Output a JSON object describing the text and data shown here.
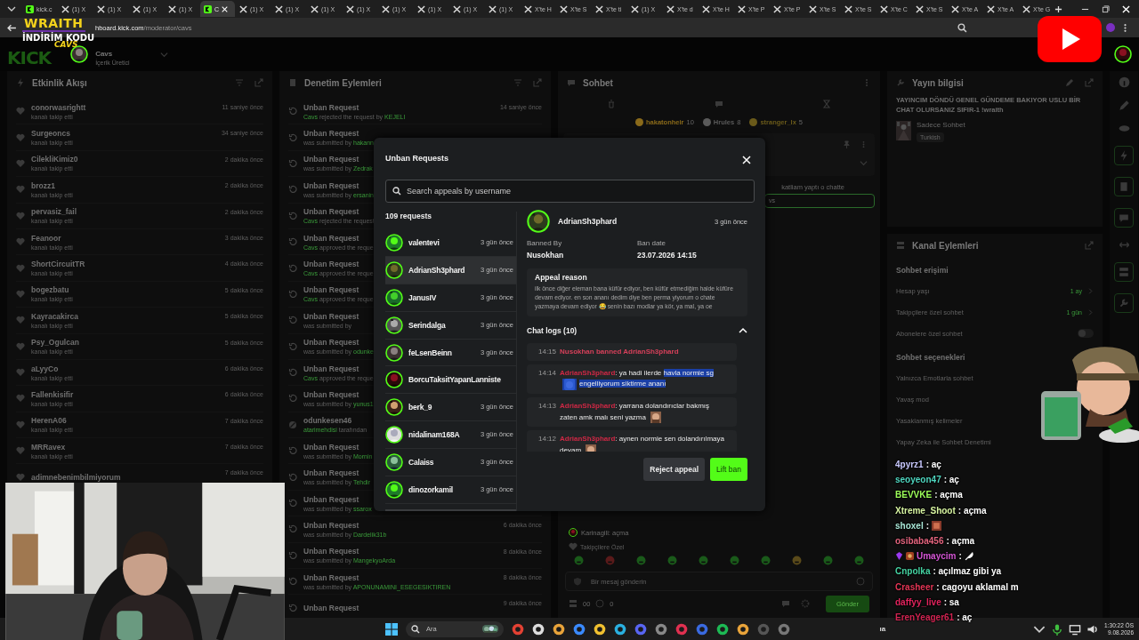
{
  "browser": {
    "tabs": [
      {
        "kind": "kick",
        "label": "kick.c",
        "selected": false
      },
      {
        "kind": "x",
        "label": "(1) X",
        "selected": false
      },
      {
        "kind": "x",
        "label": "(1) X",
        "selected": false
      },
      {
        "kind": "x",
        "label": "(1) X",
        "selected": false
      },
      {
        "kind": "x",
        "label": "(1) X",
        "selected": false
      },
      {
        "kind": "kick",
        "label": "C",
        "selected": true
      },
      {
        "kind": "x",
        "label": "(1) X",
        "selected": false
      },
      {
        "kind": "x",
        "label": "(1) X",
        "selected": false
      },
      {
        "kind": "x",
        "label": "(1) X",
        "selected": false
      },
      {
        "kind": "x",
        "label": "(1) X",
        "selected": false
      },
      {
        "kind": "x",
        "label": "(1) X",
        "selected": false
      },
      {
        "kind": "x",
        "label": "(1) X",
        "selected": false
      },
      {
        "kind": "x",
        "label": "(1) X",
        "selected": false
      },
      {
        "kind": "x",
        "label": "(1) X",
        "selected": false
      },
      {
        "kind": "x",
        "label": "X'te H",
        "selected": false
      },
      {
        "kind": "x",
        "label": "X'te S",
        "selected": false
      },
      {
        "kind": "x",
        "label": "X'te ti",
        "selected": false
      },
      {
        "kind": "x",
        "label": "(1) X",
        "selected": false
      },
      {
        "kind": "x",
        "label": "X'te d",
        "selected": false
      },
      {
        "kind": "x",
        "label": "X'te H",
        "selected": false
      },
      {
        "kind": "x",
        "label": "X'te P",
        "selected": false
      },
      {
        "kind": "x",
        "label": "X'te P",
        "selected": false
      },
      {
        "kind": "x",
        "label": "X'te S",
        "selected": false
      },
      {
        "kind": "x",
        "label": "X'te S",
        "selected": false
      },
      {
        "kind": "x",
        "label": "X'te C",
        "selected": false
      },
      {
        "kind": "x",
        "label": "X'te S",
        "selected": false
      },
      {
        "kind": "x",
        "label": "X'te A",
        "selected": false
      },
      {
        "kind": "x",
        "label": "X'te A",
        "selected": false
      },
      {
        "kind": "x",
        "label": "X'te G",
        "selected": false
      }
    ],
    "address": {
      "host": "hboard.kick.com",
      "path": "/moderator/cavs"
    }
  },
  "promo_overlay": {
    "brand": "WRAITH",
    "line": "İNDİRİM KODU",
    "code": "CAVS"
  },
  "header": {
    "logo": "KICK",
    "channel": "Cavs",
    "role": "İçerik Üretici"
  },
  "activity": {
    "title": "Etkinlik Akışı",
    "items": [
      {
        "name": "conorwasrightt",
        "action": "kanalı takip etti",
        "time": "11 saniye önce"
      },
      {
        "name": "Surgeoncs",
        "action": "kanalı takip etti",
        "time": "34 saniye önce"
      },
      {
        "name": "CilekliKimiz0",
        "action": "kanalı takip etti",
        "time": "2 dakika önce"
      },
      {
        "name": "brozz1",
        "action": "kanalı takip etti",
        "time": "2 dakika önce"
      },
      {
        "name": "pervasiz_fail",
        "action": "kanalı takip etti",
        "time": "2 dakika önce"
      },
      {
        "name": "Feanoor",
        "action": "kanalı takip etti",
        "time": "3 dakika önce"
      },
      {
        "name": "ShortCircuitTR",
        "action": "kanalı takip etti",
        "time": "4 dakika önce"
      },
      {
        "name": "bogezbatu",
        "action": "kanalı takip etti",
        "time": "5 dakika önce"
      },
      {
        "name": "Kayracakirca",
        "action": "kanalı takip etti",
        "time": "5 dakika önce"
      },
      {
        "name": "Psy_Ogulcan",
        "action": "kanalı takip etti",
        "time": "5 dakika önce"
      },
      {
        "name": "aLyyCo",
        "action": "kanalı takip etti",
        "time": "6 dakika önce"
      },
      {
        "name": "Fallenkisifir",
        "action": "kanalı takip etti",
        "time": "6 dakika önce"
      },
      {
        "name": "HerenA06",
        "action": "kanalı takip etti",
        "time": "7 dakika önce"
      },
      {
        "name": "MRRavex",
        "action": "kanalı takip etti",
        "time": "7 dakika önce"
      },
      {
        "name": "adimnebenimbilmiyorum",
        "time": "7 dakika önce"
      }
    ]
  },
  "moderation": {
    "title": "Denetim Eylemleri",
    "items": [
      {
        "kind": "unban",
        "title": "Unban Request",
        "actor": "Cavs",
        "text": " rejected the request by ",
        "target": "KEJELI",
        "time": "14 saniye önce"
      },
      {
        "kind": "unban",
        "title": "Unban Request",
        "text": "was submitted by ",
        "target": "hakann"
      },
      {
        "kind": "unban",
        "title": "Unban Request",
        "text": "was submitted by ",
        "target": "Zedrak"
      },
      {
        "kind": "unban",
        "title": "Unban Request",
        "text": "was submitted by ",
        "target": "ersanin"
      },
      {
        "kind": "unban",
        "title": "Unban Request",
        "actor": "Cavs",
        "text": " rejected the request"
      },
      {
        "kind": "unban",
        "title": "Unban Request",
        "actor": "Cavs",
        "text": " approved the reque"
      },
      {
        "kind": "unban",
        "title": "Unban Request",
        "actor": "Cavs",
        "text": " approved the reque"
      },
      {
        "kind": "unban",
        "title": "Unban Request",
        "actor": "Cavs",
        "text": " approved the reque"
      },
      {
        "kind": "unban",
        "title": "Unban Request",
        "text": "was submitted by "
      },
      {
        "kind": "unban",
        "title": "Unban Request",
        "text": "was submitted by ",
        "target": "odunke"
      },
      {
        "kind": "unban",
        "title": "Unban Request",
        "actor": "Cavs",
        "text": " approved the reque"
      },
      {
        "kind": "unban",
        "title": "Unban Request",
        "text": "was submitted by ",
        "target": "yunus1"
      },
      {
        "kind": "ban",
        "title": "odunkesen46",
        "actor": "atarimehdisi",
        "text": " tarafından"
      },
      {
        "kind": "unban",
        "title": "Unban Request",
        "text": "was submitted by ",
        "target": "Mornin"
      },
      {
        "kind": "unban",
        "title": "Unban Request",
        "text": "was submitted by ",
        "target": "Tehdir"
      },
      {
        "kind": "unban",
        "title": "Unban Request",
        "text": "was submitted by ",
        "target": "ssarox"
      },
      {
        "kind": "unban",
        "title": "Unban Request",
        "text": "was submitted by ",
        "target": "Dardelik31b",
        "time": "6 dakika önce"
      },
      {
        "kind": "unban",
        "title": "Unban Request",
        "text": "was submitted by ",
        "target": "MangekyoArda",
        "time": "8 dakika önce"
      },
      {
        "kind": "unban",
        "title": "Unban Request",
        "text": "was submitted by ",
        "target": "APONUNAMINI_ESEGESIKTIREN",
        "time": "8 dakika önce"
      },
      {
        "kind": "unban",
        "title": "Unban Request",
        "time": "9 dakika önce"
      }
    ]
  },
  "chat": {
    "title": "Sohbet",
    "leaders": [
      {
        "name": "hakatonheir",
        "score": "10",
        "color": "#8a6a1a"
      },
      {
        "name": "Hrules",
        "score": "8",
        "color": "#5a5a5a"
      },
      {
        "name": "stranger_lx",
        "score": "5",
        "color": "#6a5a1a"
      }
    ],
    "pinned_note": "katliam yaptı o chatte",
    "pinned_input": "vs",
    "messages": [
      {
        "text": "Karinagili: açma"
      }
    ],
    "follower_label": "Takipçilere Özel",
    "input": {
      "placeholder": "Bir mesaj gönderin"
    },
    "points": "00",
    "count": "0",
    "send": "Gönder"
  },
  "stream_info": {
    "title": "Yayın bilgisi",
    "stream_title": "YAYINCIM DÖNDÜ GENEL GÜNDEME BAKIYOR USLU BİR CHAT OLURSANIZ SIFIR-1 !wraith",
    "category": "Sadece Sohbet",
    "language": "Turkish"
  },
  "channel_actions": {
    "title": "Kanal Eylemleri",
    "sections": [
      {
        "heading": "Sohbet erişimi",
        "rows": [
          {
            "kind": "link",
            "label": "Hesap yaşı",
            "value": "1 ay"
          },
          {
            "kind": "link",
            "label": "Takipçilere özel sohbet",
            "value": "1 gün"
          },
          {
            "kind": "toggle",
            "label": "Abonelere özel sohbet",
            "on": false
          }
        ]
      },
      {
        "heading": "Sohbet seçenekleri",
        "rows": [
          {
            "kind": "plain",
            "label": "Yalnızca Emotlarla sohbet"
          },
          {
            "kind": "plain",
            "label": "Yavaş mod"
          },
          {
            "kind": "plain",
            "label": "Yasaklanmış kelimeler"
          },
          {
            "kind": "plain",
            "label": "Yapay Zeka ile Sohbet Denetimi"
          }
        ]
      }
    ]
  },
  "modal": {
    "title": "Unban Requests",
    "search": {
      "placeholder": "Search appeals by username"
    },
    "count": "109 requests",
    "requests": [
      {
        "name": "valentevi",
        "time": "3 gün önce",
        "selected": false
      },
      {
        "name": "AdrianSh3phard",
        "time": "3 gün önce",
        "selected": true
      },
      {
        "name": "JanusIV",
        "time": "3 gün önce",
        "selected": false
      },
      {
        "name": "Serindalga",
        "time": "3 gün önce",
        "selected": false
      },
      {
        "name": "feLsenBeinn",
        "time": "3 gün önce",
        "selected": false
      },
      {
        "name": "BorcuTaksitYapanLanniste",
        "selected": false
      },
      {
        "name": "berk_9",
        "time": "3 gün önce",
        "selected": false
      },
      {
        "name": "nidalinam168A",
        "time": "3 gün önce",
        "selected": false
      },
      {
        "name": "Calaiss",
        "time": "3 gün önce",
        "selected": false
      },
      {
        "name": "dinozorkamil",
        "time": "3 gün önce",
        "selected": false
      }
    ],
    "detail": {
      "name": "AdrianSh3phard",
      "time": "3 gün önce",
      "banned_by_label": "Banned By",
      "banned_by": "Nusokhan",
      "ban_date_label": "Ban date",
      "ban_date": "23.07.2026 14:15",
      "appeal_label": "Appeal reason",
      "appeal": "ilk önce diğer eleman bana küfür ediyor, ben küfür etmediğim halde küfüre devam ediyor. en son ananı dedim diye ben perma yiyorum o chate yazmaya devam ediyor 😂 senin bazı modlar ya kör, ya mal, ya oe",
      "logs_label": "Chat logs (10)",
      "logs_expanded": true,
      "logs": [
        {
          "kind": "system",
          "time": "14:15",
          "text": "Nusokhan banned AdrianSh3phard"
        },
        {
          "kind": "message",
          "time": "14:14",
          "user": "AdrianSh3phard",
          "parts": [
            {
              "text": ": ya hadi ilerde ",
              "selected": false
            },
            {
              "text": "havla normie sg",
              "selected": true
            },
            {
              "kind": "emote",
              "selected": true
            },
            {
              "text": "engelliyorum siktirme ananı",
              "selected": true
            }
          ]
        },
        {
          "kind": "message",
          "time": "14:13",
          "user": "AdrianSh3phard",
          "parts": [
            {
              "text": ": yarrana dolandırıclar bakmış zaten amk malı seni yazma",
              "selected": false
            },
            {
              "kind": "emote",
              "selected": false
            }
          ]
        },
        {
          "kind": "message",
          "time": "14:12",
          "user": "AdrianSh3phard",
          "parts": [
            {
              "text": ": aynen normie sen dolandırılmaya devam",
              "selected": false
            },
            {
              "kind": "emote",
              "selected": false
            }
          ]
        }
      ]
    },
    "buttons": [
      {
        "kind": "secondary",
        "label": "Reject appeal"
      },
      {
        "kind": "primary",
        "label": "Lift ban"
      }
    ]
  },
  "stream_chat": [
    {
      "user": "4pyrz1",
      "text": ": aç",
      "color": "#c9c9ff"
    },
    {
      "user": "seoyeon47",
      "text": ": aç",
      "color": "#4fd6c0"
    },
    {
      "user": "BEVVKE",
      "text": ": açma",
      "color": "#9dff5a"
    },
    {
      "user": "Xtreme_Shoot",
      "text": ": açma",
      "color": "#d8f5a2"
    },
    {
      "user": "shoxel",
      "text": ":",
      "kind": "emote",
      "color": "#a8e6d6"
    },
    {
      "user": "osibaba456",
      "text": ": açma",
      "color": "#e3647e"
    },
    {
      "user": "Umaycim",
      "text": ":",
      "kind": "icon",
      "badges": true,
      "color": "#d455d4"
    },
    {
      "user": "Cnpolka",
      "text": ": açılmaz gibi ya",
      "color": "#45d3a2"
    },
    {
      "user": "Crasheer",
      "text": ": cagoyu aklamal m",
      "color": "#e33655"
    },
    {
      "user": "daffyy_live",
      "text": ": sa",
      "color": "#e3245e"
    },
    {
      "user": "ErenYeager61",
      "text": ": aç",
      "color": "#d22452"
    }
  ],
  "taskbar": {
    "search": {
      "placeholder": "Ara"
    },
    "tray_text": "ıa",
    "time": "1:30:22 ÖS",
    "date": "9.08.2026"
  }
}
